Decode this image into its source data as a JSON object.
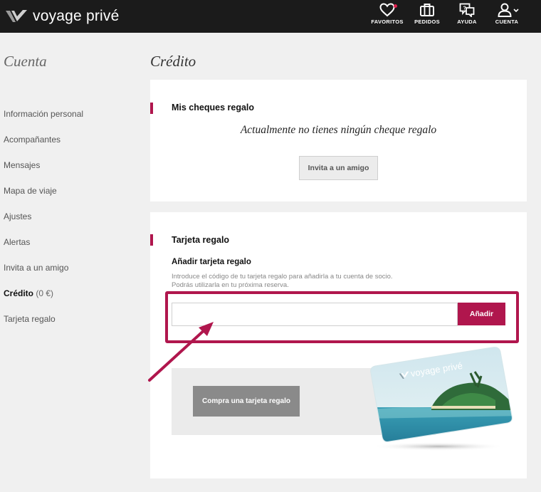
{
  "header": {
    "logo_text": "voyage privé",
    "nav": [
      {
        "label": "FAVORITOS",
        "icon": "heart-icon"
      },
      {
        "label": "PEDIDOS",
        "icon": "suitcase-icon"
      },
      {
        "label": "AYUDA",
        "icon": "chat-help-icon"
      },
      {
        "label": "CUENTA",
        "icon": "user-icon"
      }
    ]
  },
  "sidebar": {
    "title": "Cuenta",
    "items": [
      {
        "label": "Información personal"
      },
      {
        "label": "Acompañantes"
      },
      {
        "label": "Mensajes"
      },
      {
        "label": "Mapa de viaje"
      },
      {
        "label": "Ajustes"
      },
      {
        "label": "Alertas"
      },
      {
        "label": "Invita a un amigo"
      },
      {
        "label": "Crédito",
        "extra": "(0 €)",
        "active": true
      },
      {
        "label": "Tarjeta regalo"
      }
    ]
  },
  "main": {
    "title": "Crédito",
    "cheques": {
      "heading": "Mis cheques regalo",
      "empty_message": "Actualmente no tienes ningún cheque regalo",
      "invite_button": "Invita a un amigo"
    },
    "giftcard": {
      "heading": "Tarjeta regalo",
      "sub_heading": "Añadir tarjeta regalo",
      "help_line1": "Introduce el código de tu tarjeta regalo para añadirla a tu cuenta de socio.",
      "help_line2": "Podrás utilizarla en tu próxima reserva.",
      "input_value": "",
      "input_placeholder": "",
      "add_button": "Añadir",
      "buy_button": "Compra una tarjeta regalo",
      "card_logo_text": "voyage privé"
    }
  },
  "colors": {
    "accent": "#b0164d",
    "header_bg": "#1b1b1b",
    "page_bg": "#f0f0f0"
  }
}
